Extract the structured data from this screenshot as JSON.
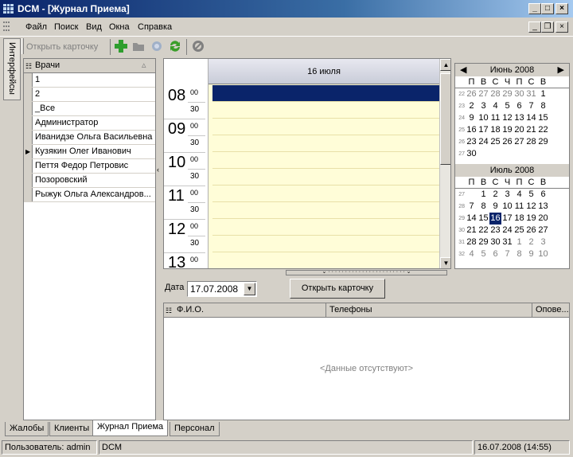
{
  "window": {
    "title": "DCM - [Журнал Приема]"
  },
  "menu": [
    "Файл",
    "Поиск",
    "Вид",
    "Окна",
    "Справка"
  ],
  "side_tab": "Интерфейсы",
  "toolbar": {
    "open_card_label": "Открыть карточку"
  },
  "doctors": {
    "header": "Врачи",
    "items": [
      "1",
      "2",
      "_Все",
      "Администратор",
      "Иванидзе Ольга Васильевна",
      "Кузякин Олег Иванович",
      "Пеття Федор Петровис",
      "Позоровский",
      "Рыжук Ольга Александров..."
    ],
    "current_index": 5
  },
  "schedule": {
    "date_header": "16 июля",
    "hours": [
      "08",
      "09",
      "10",
      "11",
      "12",
      "13"
    ],
    "minutes_top": "00",
    "minutes_half": "30"
  },
  "calendar_june": {
    "title": "Июнь 2008",
    "days": [
      "П",
      "В",
      "С",
      "Ч",
      "П",
      "С",
      "В"
    ],
    "weeks": [
      {
        "wk": "22",
        "d": [
          "26",
          "27",
          "28",
          "29",
          "30",
          "31",
          "1"
        ]
      },
      {
        "wk": "23",
        "d": [
          "2",
          "3",
          "4",
          "5",
          "6",
          "7",
          "8"
        ]
      },
      {
        "wk": "24",
        "d": [
          "9",
          "10",
          "11",
          "12",
          "13",
          "14",
          "15"
        ]
      },
      {
        "wk": "25",
        "d": [
          "16",
          "17",
          "18",
          "19",
          "20",
          "21",
          "22"
        ]
      },
      {
        "wk": "26",
        "d": [
          "23",
          "24",
          "25",
          "26",
          "27",
          "28",
          "29"
        ]
      },
      {
        "wk": "27",
        "d": [
          "30"
        ]
      }
    ]
  },
  "calendar_july": {
    "title": "Июль 2008",
    "days": [
      "П",
      "В",
      "С",
      "Ч",
      "П",
      "С",
      "В"
    ],
    "weeks": [
      {
        "wk": "27",
        "d": [
          "",
          "1",
          "2",
          "3",
          "4",
          "5",
          "6"
        ]
      },
      {
        "wk": "28",
        "d": [
          "7",
          "8",
          "9",
          "10",
          "11",
          "12",
          "13"
        ]
      },
      {
        "wk": "29",
        "d": [
          "14",
          "15",
          "16",
          "17",
          "18",
          "19",
          "20"
        ]
      },
      {
        "wk": "30",
        "d": [
          "21",
          "22",
          "23",
          "24",
          "25",
          "26",
          "27"
        ]
      },
      {
        "wk": "31",
        "d": [
          "28",
          "29",
          "30",
          "31",
          "1",
          "2",
          "3"
        ]
      },
      {
        "wk": "32",
        "d": [
          "4",
          "5",
          "6",
          "7",
          "8",
          "9",
          "10"
        ]
      }
    ],
    "today": "16"
  },
  "date_filter": {
    "label": "Дата",
    "value": "17.07.2008"
  },
  "open_card_button": "Открыть карточку",
  "patients": {
    "columns": [
      "Ф.И.О.",
      "Телефоны",
      "Опове..."
    ],
    "empty_text": "<Данные отсутствуют>"
  },
  "bottom_tabs": [
    "Жалобы",
    "Клиенты",
    "Журнал Приема",
    "Персонал"
  ],
  "active_tab": "Журнал Приема",
  "statusbar": {
    "user": "Пользователь: admin",
    "app": "DCM",
    "datetime": "16.07.2008 (14:55)"
  }
}
